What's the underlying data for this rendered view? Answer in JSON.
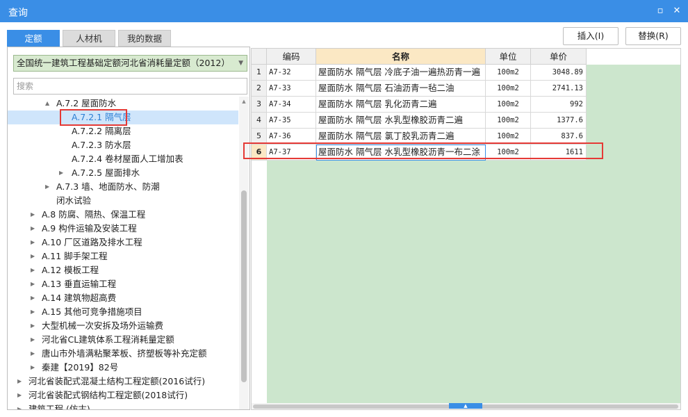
{
  "window": {
    "title": "查询",
    "restore_icon": "restore-icon",
    "close_icon": "close-icon"
  },
  "tabs": [
    {
      "label": "定额",
      "active": true
    },
    {
      "label": "人材机",
      "active": false
    },
    {
      "label": "我的数据",
      "active": false
    }
  ],
  "actions": {
    "insert_label": "插入(I)",
    "replace_label": "替换(R)"
  },
  "left": {
    "quota_select": "全国统一建筑工程基础定额河北省消耗量定额（2012）",
    "search_placeholder": "搜索",
    "tree": [
      {
        "label": "A.7.2 屋面防水",
        "level": 2,
        "arrow": "▲",
        "expanded": true
      },
      {
        "label": "A.7.2.1 隔气层",
        "level": 3,
        "arrow": "",
        "selected": true
      },
      {
        "label": "A.7.2.2 隔离层",
        "level": 3,
        "arrow": ""
      },
      {
        "label": "A.7.2.3 防水层",
        "level": 3,
        "arrow": ""
      },
      {
        "label": "A.7.2.4 卷材屋面人工增加表",
        "level": 3,
        "arrow": ""
      },
      {
        "label": "A.7.2.5 屋面排水",
        "level": 3,
        "arrow": "▶"
      },
      {
        "label": "A.7.3 墙、地面防水、防潮",
        "level": 2,
        "arrow": "▶"
      },
      {
        "label": "闭水试验",
        "level": 2,
        "arrow": ""
      },
      {
        "label": "A.8 防腐、隔热、保温工程",
        "level": 1,
        "arrow": "▶"
      },
      {
        "label": "A.9 构件运输及安装工程",
        "level": 1,
        "arrow": "▶"
      },
      {
        "label": "A.10 厂区道路及排水工程",
        "level": 1,
        "arrow": "▶"
      },
      {
        "label": "A.11 脚手架工程",
        "level": 1,
        "arrow": "▶"
      },
      {
        "label": "A.12 模板工程",
        "level": 1,
        "arrow": "▶"
      },
      {
        "label": "A.13 垂直运输工程",
        "level": 1,
        "arrow": "▶"
      },
      {
        "label": "A.14 建筑物超高费",
        "level": 1,
        "arrow": "▶"
      },
      {
        "label": "A.15 其他可竞争措施项目",
        "level": 1,
        "arrow": "▶"
      },
      {
        "label": "大型机械一次安拆及场外运输费",
        "level": 1,
        "arrow": "▶"
      },
      {
        "label": "河北省CL建筑体系工程消耗量定额",
        "level": 1,
        "arrow": "▶"
      },
      {
        "label": "唐山市外墙满粘聚苯板、挤塑板等补充定额",
        "level": 1,
        "arrow": "▶"
      },
      {
        "label": "秦建【2019】82号",
        "level": 1,
        "arrow": "▶"
      },
      {
        "label": "河北省装配式混凝土结构工程定额(2016试行)",
        "level": 0,
        "arrow": "▶"
      },
      {
        "label": "河北省装配式钢结构工程定额(2018试行)",
        "level": 0,
        "arrow": "▶"
      },
      {
        "label": "建筑工程 (仿古)",
        "level": 0,
        "arrow": "▶"
      }
    ]
  },
  "table": {
    "headers": [
      "编码",
      "名称",
      "单位",
      "单价"
    ],
    "rows": [
      {
        "index": "1",
        "code": "A7-32",
        "name": "屋面防水 隔气层 冷底子油一遍热沥青一遍",
        "unit": "100m2",
        "price": "3048.89"
      },
      {
        "index": "2",
        "code": "A7-33",
        "name": "屋面防水 隔气层 石油沥青一毡二油",
        "unit": "100m2",
        "price": "2741.13"
      },
      {
        "index": "3",
        "code": "A7-34",
        "name": "屋面防水 隔气层 乳化沥青二遍",
        "unit": "100m2",
        "price": "992"
      },
      {
        "index": "4",
        "code": "A7-35",
        "name": "屋面防水 隔气层 水乳型橡胶沥青二遍",
        "unit": "100m2",
        "price": "1377.6"
      },
      {
        "index": "5",
        "code": "A7-36",
        "name": "屋面防水 隔气层 氯丁胶乳沥青二遍",
        "unit": "100m2",
        "price": "837.6"
      },
      {
        "index": "6",
        "code": "A7-37",
        "name": "屋面防水 隔气层 水乳型橡胶沥青一布二涂",
        "unit": "100m2",
        "price": "1611",
        "current": true
      }
    ]
  },
  "colors": {
    "accent": "#3a8ee6",
    "highlight_box": "#e53935",
    "grid_background": "#cce6cd"
  }
}
